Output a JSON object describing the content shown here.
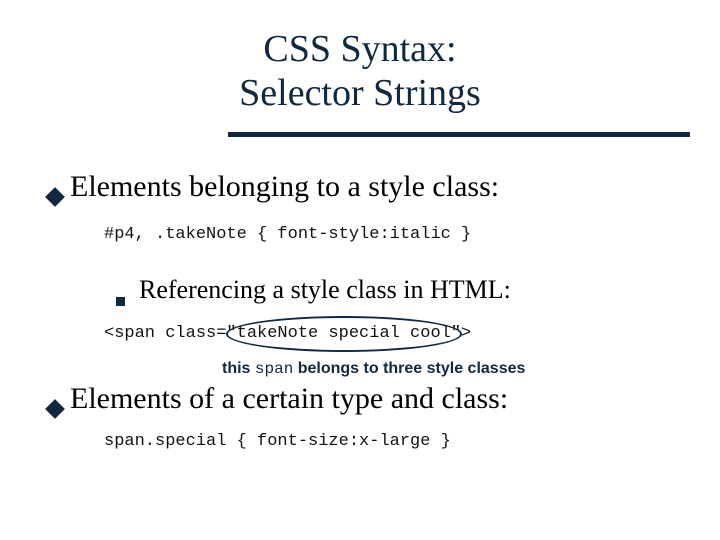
{
  "title": {
    "line1": "CSS Syntax:",
    "line2": "Selector Strings"
  },
  "bullets": {
    "b1": "Elements belonging to a style class:",
    "sub1": "Referencing a style class in HTML:",
    "b2": "Elements of a certain type and class:"
  },
  "code": {
    "c1": "#p4, .takeNote { font-style:italic }",
    "c2": "<span class=\"takeNote special cool\">",
    "c3": "span.special { font-size:x-large }"
  },
  "note": {
    "prefix": "this ",
    "mono": "span",
    "suffix": " belongs to three style classes"
  }
}
